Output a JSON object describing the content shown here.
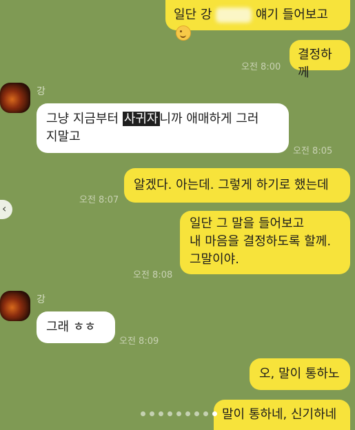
{
  "messages": [
    {
      "id": "m1",
      "side": "me",
      "pre": "일단 강",
      "post": "얘기 들어보고"
    },
    {
      "id": "m2",
      "side": "me",
      "text": "결정하께",
      "time": "오전 8:00"
    },
    {
      "id": "m3",
      "side": "them",
      "name": "강",
      "pre": "그냥 지금부터 ",
      "highlight": "사귀자",
      "post": "니까 애매하게 그러",
      "line2": "지말고",
      "time": "오전 8:05"
    },
    {
      "id": "m4",
      "side": "me",
      "text": "알겠다. 아는데. 그렇게 하기로 했는데",
      "time": "오전 8:07"
    },
    {
      "id": "m5",
      "side": "me",
      "lines": [
        "일단 그 말을 들어보고",
        "내 마음을 결정하도록 할께.",
        "그말이야."
      ],
      "time": "오전 8:08"
    },
    {
      "id": "m6",
      "side": "them",
      "name": "강",
      "text": "그래 ㅎㅎ",
      "time": "오전 8:09"
    },
    {
      "id": "m7",
      "side": "me",
      "text": "오, 말이 통하노"
    },
    {
      "id": "m8",
      "side": "me",
      "text": "말이 통하네, 신기하네"
    }
  ],
  "icons": {
    "emoji": "winking-smiley-emoji",
    "pager": "chevron-left-icon"
  },
  "pager_glyph": "‹",
  "page_dots": {
    "count": 9,
    "active_index": 8
  }
}
